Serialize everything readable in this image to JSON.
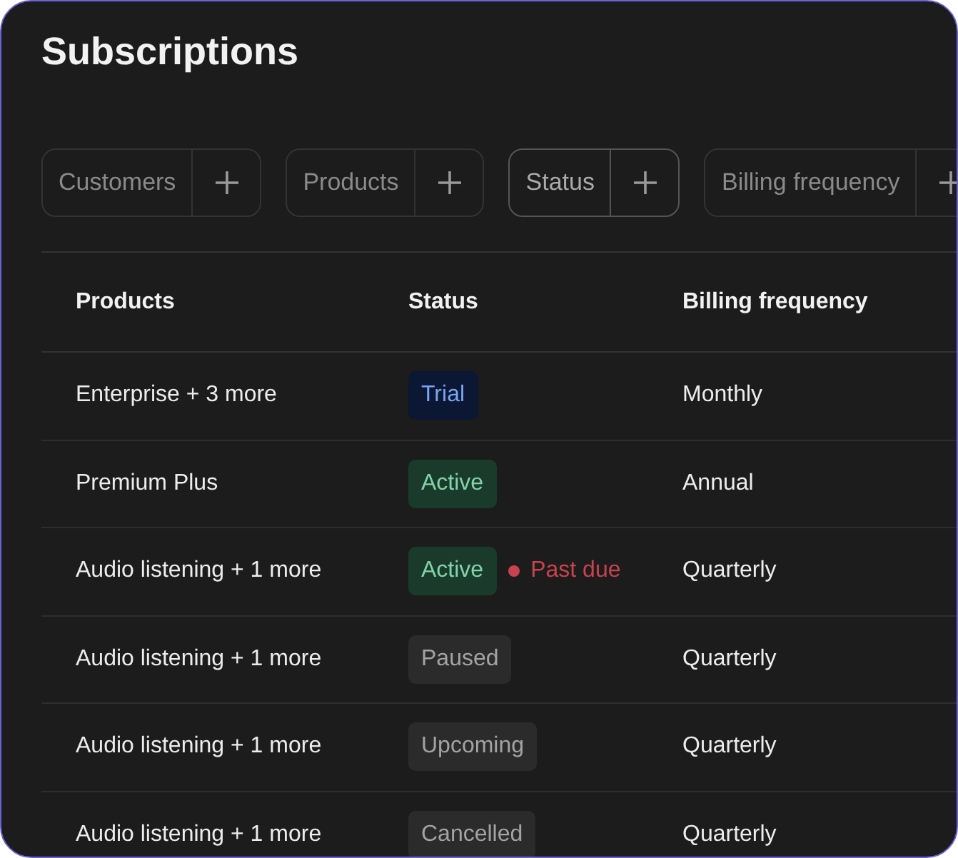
{
  "title": "Subscriptions",
  "filters": [
    {
      "label": "Customers",
      "selected": false
    },
    {
      "label": "Products",
      "selected": false
    },
    {
      "label": "Status",
      "selected": true
    },
    {
      "label": "Billing frequency",
      "selected": false
    }
  ],
  "table": {
    "columns": [
      "Products",
      "Status",
      "Billing frequency"
    ],
    "rows": [
      {
        "products": "Enterprise + 3 more",
        "status": {
          "label": "Trial",
          "kind": "trial"
        },
        "billing": "Monthly"
      },
      {
        "products": "Premium Plus",
        "status": {
          "label": "Active",
          "kind": "active"
        },
        "billing": "Annual"
      },
      {
        "products": "Audio listening + 1 more",
        "status": {
          "label": "Active",
          "kind": "active"
        },
        "alert": "Past due",
        "billing": "Quarterly"
      },
      {
        "products": "Audio listening + 1 more",
        "status": {
          "label": "Paused",
          "kind": "neutral"
        },
        "billing": "Quarterly"
      },
      {
        "products": "Audio listening + 1 more",
        "status": {
          "label": "Upcoming",
          "kind": "neutral"
        },
        "billing": "Quarterly"
      },
      {
        "products": "Audio listening + 1 more",
        "status": {
          "label": "Cancelled",
          "kind": "neutral"
        },
        "billing": "Quarterly"
      }
    ]
  }
}
